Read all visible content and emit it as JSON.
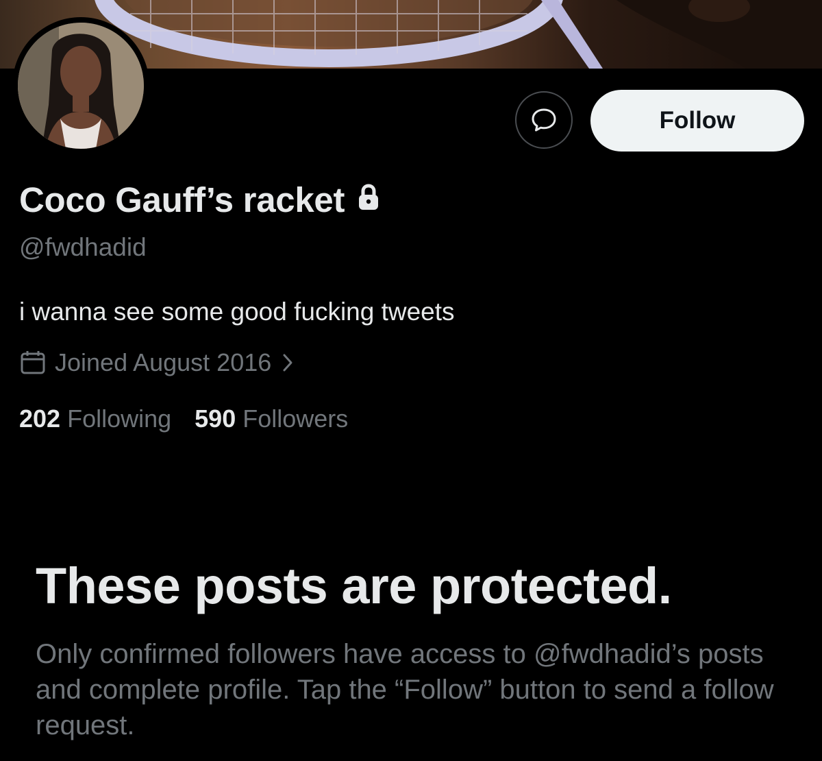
{
  "profile": {
    "display_name": "Coco Gauff’s racket",
    "handle": "@fwdhadid",
    "bio": "i wanna see some good fucking tweets",
    "joined": "Joined August 2016",
    "following_count": "202",
    "following_label": "Following",
    "followers_count": "590",
    "followers_label": "Followers"
  },
  "actions": {
    "follow_label": "Follow",
    "message_icon": "message-bubble-icon"
  },
  "protected": {
    "title": "These posts are protected.",
    "body": "Only confirmed followers have access to @fwdhadid’s posts and complete profile. Tap the “Follow” button to send a follow request."
  },
  "colors": {
    "background": "#000000",
    "text_primary": "#e7e9ea",
    "text_secondary": "#71767b",
    "button_bg": "#eff3f4"
  },
  "icons": [
    "lock-icon",
    "calendar-icon",
    "chevron-right-icon",
    "message-bubble-icon"
  ]
}
